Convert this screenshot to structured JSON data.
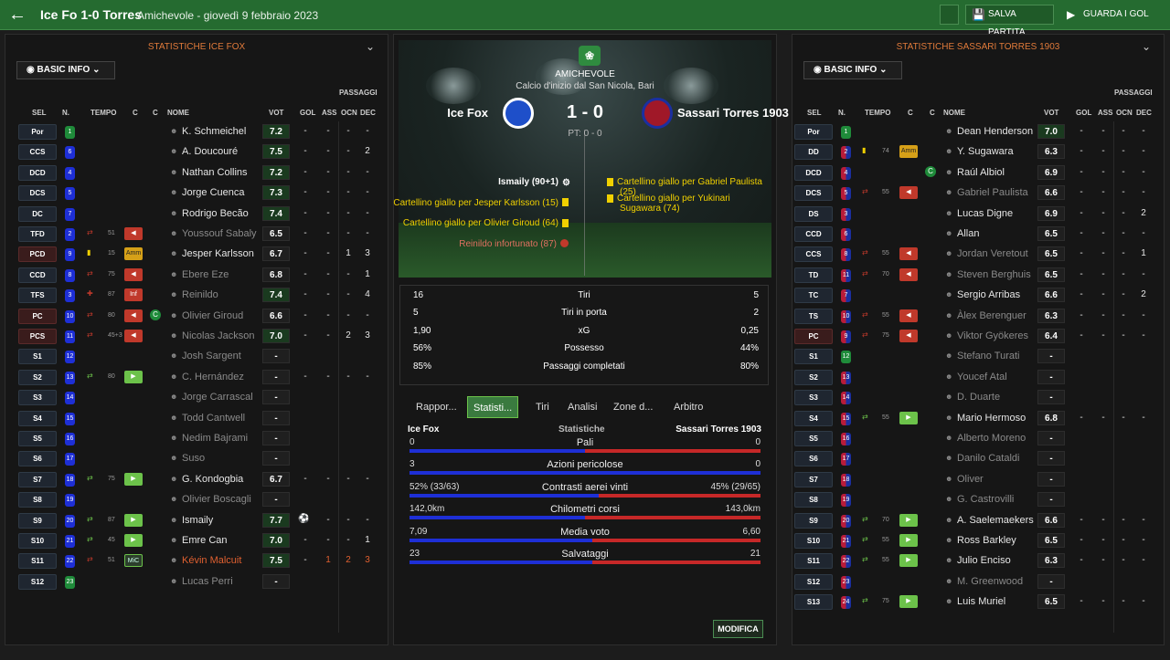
{
  "header": {
    "title": "Ice Fo 1-0 Torres",
    "subtitle": "Amichevole - giovedì 9 febbraio 2023",
    "save_label": "SALVA PARTITA",
    "goals_label": "GUARDA I GOL"
  },
  "left": {
    "title": "STATISTICHE ICE FOX",
    "info_label": "BASIC INFO",
    "cols": {
      "sel": "SEL",
      "n": "N.",
      "tempo": "TEMPO",
      "c1": "C",
      "c2": "C",
      "nome": "NOME",
      "vot": "VOT",
      "gol": "GOL",
      "ass": "ASS",
      "passaggi": "PASSAGGI",
      "ocn": "OCN",
      "dec": "DEC"
    },
    "players": [
      {
        "pos": "Por",
        "n": "1",
        "nm": "K. Schmeichel",
        "v": "7.2",
        "g": "-",
        "a": "-",
        "o": "-",
        "d": "-"
      },
      {
        "pos": "CCS",
        "n": "6",
        "nm": "A. Doucouré",
        "v": "7.5",
        "g": "-",
        "a": "-",
        "o": "-",
        "d": "2"
      },
      {
        "pos": "DCD",
        "n": "4",
        "nm": "Nathan Collins",
        "v": "7.2",
        "g": "-",
        "a": "-",
        "o": "-",
        "d": "-"
      },
      {
        "pos": "DCS",
        "n": "5",
        "nm": "Jorge Cuenca",
        "v": "7.3",
        "g": "-",
        "a": "-",
        "o": "-",
        "d": "-"
      },
      {
        "pos": "DC",
        "n": "7",
        "nm": "Rodrigo Becão",
        "v": "7.4",
        "g": "-",
        "a": "-",
        "o": "-",
        "d": "-"
      },
      {
        "pos": "TFD",
        "n": "2",
        "nm": "Youssouf Sabaly",
        "v": "6.5",
        "g": "-",
        "a": "-",
        "o": "-",
        "d": "-",
        "t": "51",
        "ev": "sub"
      },
      {
        "pos": "PCD",
        "n": "9",
        "nm": "Jesper Karlsson",
        "v": "6.7",
        "g": "-",
        "a": "-",
        "o": "1",
        "d": "3",
        "t": "15",
        "ev": "amm"
      },
      {
        "pos": "CCD",
        "n": "8",
        "nm": "Ebere Eze",
        "v": "6.8",
        "g": "-",
        "a": "-",
        "o": "-",
        "d": "1",
        "t": "75",
        "ev": "sub"
      },
      {
        "pos": "TFS",
        "n": "3",
        "nm": "Reinildo",
        "v": "7.4",
        "g": "-",
        "a": "-",
        "o": "-",
        "d": "4",
        "t": "87",
        "ev": "inf"
      },
      {
        "pos": "PC",
        "n": "10",
        "nm": "Olivier Giroud",
        "v": "6.6",
        "g": "-",
        "a": "-",
        "o": "-",
        "d": "-",
        "t": "80",
        "ev": "sub"
      },
      {
        "pos": "PCS",
        "n": "11",
        "nm": "Nicolas Jackson",
        "v": "7.0",
        "g": "-",
        "a": "-",
        "o": "2",
        "d": "3",
        "t": "45+3",
        "ev": "sub"
      },
      {
        "pos": "S1",
        "n": "12",
        "nm": "Josh Sargent",
        "v": "-",
        "g": "",
        "a": "",
        "o": "",
        "d": ""
      },
      {
        "pos": "S2",
        "n": "13",
        "nm": "C. Hernández",
        "v": "-",
        "g": "-",
        "a": "-",
        "o": "-",
        "d": "-",
        "t": "80",
        "ev": "in"
      },
      {
        "pos": "S3",
        "n": "14",
        "nm": "Jorge Carrascal",
        "v": "-",
        "g": "",
        "a": "",
        "o": "",
        "d": ""
      },
      {
        "pos": "S4",
        "n": "15",
        "nm": "Todd Cantwell",
        "v": "-",
        "g": "",
        "a": "",
        "o": "",
        "d": ""
      },
      {
        "pos": "S5",
        "n": "16",
        "nm": "Nedim Bajrami",
        "v": "-",
        "g": "",
        "a": "",
        "o": "",
        "d": ""
      },
      {
        "pos": "S6",
        "n": "17",
        "nm": "Suso",
        "v": "-",
        "g": "",
        "a": "",
        "o": "",
        "d": ""
      },
      {
        "pos": "S7",
        "n": "18",
        "nm": "G. Kondogbia",
        "v": "6.7",
        "g": "-",
        "a": "-",
        "o": "-",
        "d": "-",
        "t": "75",
        "ev": "in"
      },
      {
        "pos": "S8",
        "n": "19",
        "nm": "Olivier Boscagli",
        "v": "-",
        "g": "",
        "a": "",
        "o": "",
        "d": ""
      },
      {
        "pos": "S9",
        "n": "20",
        "nm": "Ismaily",
        "v": "7.7",
        "g": "⚽",
        "a": "-",
        "o": "-",
        "d": "-",
        "t": "87",
        "ev": "in"
      },
      {
        "pos": "S10",
        "n": "21",
        "nm": "Emre Can",
        "v": "7.0",
        "g": "-",
        "a": "-",
        "o": "-",
        "d": "1",
        "t": "45",
        "ev": "in"
      },
      {
        "pos": "S11",
        "n": "22",
        "nm": "Kévin Malcuit",
        "v": "7.5",
        "g": "-",
        "a": "1",
        "o": "2",
        "d": "3",
        "t": "51",
        "ev": "mc"
      },
      {
        "pos": "S12",
        "n": "23",
        "nm": "Lucas Perri",
        "v": "-",
        "g": "",
        "a": "",
        "o": "",
        "d": ""
      }
    ]
  },
  "right": {
    "title": "STATISTICHE SASSARI TORRES 1903",
    "info_label": "BASIC INFO",
    "players": [
      {
        "pos": "Por",
        "n": "1",
        "nm": "Dean Henderson",
        "v": "7.0",
        "g": "-",
        "a": "-",
        "o": "-",
        "d": "-"
      },
      {
        "pos": "DD",
        "n": "2",
        "nm": "Y. Sugawara",
        "v": "6.3",
        "g": "-",
        "a": "-",
        "o": "-",
        "d": "-",
        "t": "74",
        "ev": "amm"
      },
      {
        "pos": "DCD",
        "n": "4",
        "nm": "Raúl Albiol",
        "v": "6.9",
        "g": "-",
        "a": "-",
        "o": "-",
        "d": "-"
      },
      {
        "pos": "DCS",
        "n": "5",
        "nm": "Gabriel Paulista",
        "v": "6.6",
        "g": "-",
        "a": "-",
        "o": "-",
        "d": "-",
        "t": "55",
        "ev": "sub"
      },
      {
        "pos": "DS",
        "n": "3",
        "nm": "Lucas Digne",
        "v": "6.9",
        "g": "-",
        "a": "-",
        "o": "-",
        "d": "2"
      },
      {
        "pos": "CCD",
        "n": "6",
        "nm": "Allan",
        "v": "6.5",
        "g": "-",
        "a": "-",
        "o": "-",
        "d": "-"
      },
      {
        "pos": "CCS",
        "n": "8",
        "nm": "Jordan Veretout",
        "v": "6.5",
        "g": "-",
        "a": "-",
        "o": "-",
        "d": "1",
        "t": "55",
        "ev": "sub"
      },
      {
        "pos": "TD",
        "n": "11",
        "nm": "Steven Berghuis",
        "v": "6.5",
        "g": "-",
        "a": "-",
        "o": "-",
        "d": "-",
        "t": "70",
        "ev": "sub"
      },
      {
        "pos": "TC",
        "n": "7",
        "nm": "Sergio Arribas",
        "v": "6.6",
        "g": "-",
        "a": "-",
        "o": "-",
        "d": "2"
      },
      {
        "pos": "TS",
        "n": "10",
        "nm": "Àlex Berenguer",
        "v": "6.3",
        "g": "-",
        "a": "-",
        "o": "-",
        "d": "-",
        "t": "55",
        "ev": "sub"
      },
      {
        "pos": "PC",
        "n": "9",
        "nm": "Viktor Gyökeres",
        "v": "6.4",
        "g": "-",
        "a": "-",
        "o": "-",
        "d": "-",
        "t": "75",
        "ev": "sub"
      },
      {
        "pos": "S1",
        "n": "12",
        "nm": "Stefano Turati",
        "v": "-",
        "g": "",
        "a": "",
        "o": "",
        "d": ""
      },
      {
        "pos": "S2",
        "n": "13",
        "nm": "Youcef Atal",
        "v": "-",
        "g": "",
        "a": "",
        "o": "",
        "d": ""
      },
      {
        "pos": "S3",
        "n": "14",
        "nm": "D. Duarte",
        "v": "-",
        "g": "",
        "a": "",
        "o": "",
        "d": ""
      },
      {
        "pos": "S4",
        "n": "15",
        "nm": "Mario Hermoso",
        "v": "6.8",
        "g": "-",
        "a": "-",
        "o": "-",
        "d": "-",
        "t": "55",
        "ev": "in"
      },
      {
        "pos": "S5",
        "n": "16",
        "nm": "Alberto Moreno",
        "v": "-",
        "g": "",
        "a": "",
        "o": "",
        "d": ""
      },
      {
        "pos": "S6",
        "n": "17",
        "nm": "Danilo Cataldi",
        "v": "-",
        "g": "",
        "a": "",
        "o": "",
        "d": ""
      },
      {
        "pos": "S7",
        "n": "18",
        "nm": "Oliver",
        "v": "-",
        "g": "",
        "a": "",
        "o": "",
        "d": ""
      },
      {
        "pos": "S8",
        "n": "19",
        "nm": "G. Castrovilli",
        "v": "-",
        "g": "",
        "a": "",
        "o": "",
        "d": ""
      },
      {
        "pos": "S9",
        "n": "20",
        "nm": "A. Saelemaekers",
        "v": "6.6",
        "g": "-",
        "a": "-",
        "o": "-",
        "d": "-",
        "t": "70",
        "ev": "in"
      },
      {
        "pos": "S10",
        "n": "21",
        "nm": "Ross Barkley",
        "v": "6.5",
        "g": "-",
        "a": "-",
        "o": "-",
        "d": "-",
        "t": "55",
        "ev": "in"
      },
      {
        "pos": "S11",
        "n": "22",
        "nm": "Julio Enciso",
        "v": "6.3",
        "g": "-",
        "a": "-",
        "o": "-",
        "d": "-",
        "t": "55",
        "ev": "in"
      },
      {
        "pos": "S12",
        "n": "23",
        "nm": "M. Greenwood",
        "v": "-",
        "g": "",
        "a": "",
        "o": "",
        "d": ""
      },
      {
        "pos": "S13",
        "n": "24",
        "nm": "Luis Muriel",
        "v": "6.5",
        "g": "-",
        "a": "-",
        "o": "-",
        "d": "-",
        "t": "75",
        "ev": "in"
      }
    ]
  },
  "center": {
    "competition": "AMICHEVOLE",
    "kickoff": "Calcio d'inizio dal San Nicola, Bari",
    "home": "Ice Fox",
    "away": "Sassari Torres 1903",
    "score": "1 - 0",
    "ht": "PT: 0 - 0",
    "events_left": [
      {
        "t": "Ismaily (90+1)",
        "type": "goal"
      },
      {
        "t": "Cartellino giallo per Jesper Karlsson (15)",
        "type": "yellow"
      },
      {
        "t": "Cartellino giallo per Olivier Giroud (64)",
        "type": "yellow"
      },
      {
        "t": "Reinildo infortunato (87)",
        "type": "injury"
      }
    ],
    "events_right": [
      {
        "t": "Cartellino giallo per Gabriel Paulista (25)"
      },
      {
        "t": "Cartellino giallo per Yukinari Sugawara (74)"
      }
    ],
    "key": [
      {
        "l": "16",
        "m": "Tiri",
        "r": "5"
      },
      {
        "l": "5",
        "m": "Tiri in porta",
        "r": "2"
      },
      {
        "l": "1,90",
        "m": "xG",
        "r": "0,25"
      },
      {
        "l": "56%",
        "m": "Possesso",
        "r": "44%"
      },
      {
        "l": "85%",
        "m": "Passaggi completati",
        "r": "80%"
      }
    ],
    "tabs": [
      "Rappor...",
      "Statisti...",
      "Tiri",
      "Analisi",
      "Zone d...",
      "Arbitro"
    ],
    "stats_head": {
      "home": "Ice Fox",
      "mid": "Statistiche",
      "away": "Sassari Torres 1903"
    },
    "stats": [
      {
        "l": "0",
        "m": "Pali",
        "r": "0",
        "p": 0.5
      },
      {
        "l": "3",
        "m": "Azioni pericolose",
        "r": "0",
        "p": 1.0
      },
      {
        "l": "52% (33/63)",
        "m": "Contrasti aerei vinti",
        "r": "45% (29/65)",
        "p": 0.54
      },
      {
        "l": "142,0km",
        "m": "Chilometri corsi",
        "r": "143,0km",
        "p": 0.5
      },
      {
        "l": "7,09",
        "m": "Media voto",
        "r": "6,60",
        "p": 0.52
      },
      {
        "l": "23",
        "m": "Salvataggi",
        "r": "21",
        "p": 0.52
      }
    ],
    "modify_label": "MODIFICA"
  }
}
